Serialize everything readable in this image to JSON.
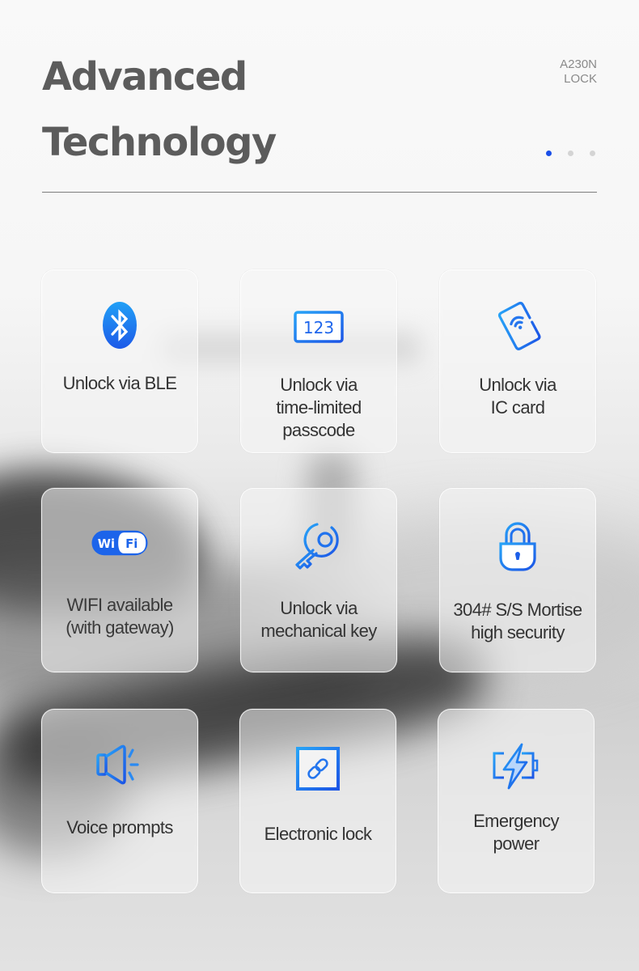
{
  "header": {
    "title_line1": "Advanced",
    "title_line2": "Technology",
    "model_line1": "A230N",
    "model_line2": "LOCK"
  },
  "pager": {
    "total": 3,
    "active": 1
  },
  "accent_color": "#1a6ff0",
  "features": [
    {
      "icon": "bluetooth-icon",
      "label": "Unlock via BLE"
    },
    {
      "icon": "passcode-icon",
      "icon_text": "123",
      "label": "Unlock via\ntime-limited\npasscode"
    },
    {
      "icon": "ic-card-icon",
      "label": "Unlock via\nIC card"
    },
    {
      "icon": "wifi-icon",
      "icon_text_a": "Wi",
      "icon_text_b": "Fi",
      "label": "WIFI available\n(with gateway)"
    },
    {
      "icon": "key-icon",
      "label": "Unlock via\nmechanical key"
    },
    {
      "icon": "padlock-icon",
      "label": "304# S/S Mortise\nhigh security"
    },
    {
      "icon": "speaker-icon",
      "label": "Voice prompts"
    },
    {
      "icon": "link-icon",
      "label": "Electronic lock"
    },
    {
      "icon": "battery-charge-icon",
      "label": "Emergency\npower"
    }
  ]
}
